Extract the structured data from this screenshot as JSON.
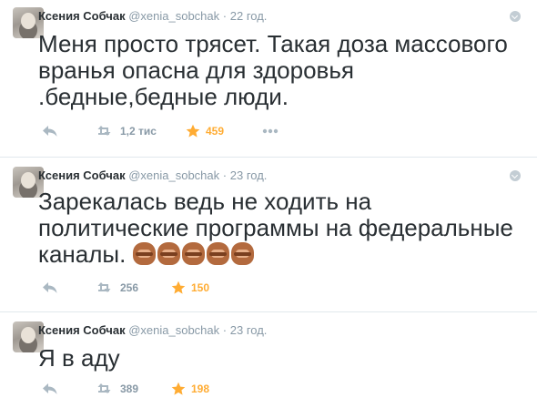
{
  "tweets": [
    {
      "name": "Ксения Собчак",
      "handle": "@xenia_sobchak",
      "separator": "·",
      "time": "22 год.",
      "text": "Меня просто трясет. Такая доза массового вранья опасна для здоровья .бедные,бедные люди.",
      "retweets": "1,2 тис",
      "favorites": "459",
      "emoji_count": 0
    },
    {
      "name": "Ксения Собчак",
      "handle": "@xenia_sobchak",
      "separator": "·",
      "time": "23 год.",
      "text": "Зарекалась ведь не ходить на политические программы на федеральные каналы.",
      "retweets": "256",
      "favorites": "150",
      "emoji_count": 5,
      "emoji_icon": "see-no-evil-monkey"
    },
    {
      "name": "Ксения Собчак",
      "handle": "@xenia_sobchak",
      "separator": "·",
      "time": "23 год.",
      "text": "Я в аду",
      "retweets": "389",
      "favorites": "198",
      "emoji_count": 0
    }
  ],
  "colors": {
    "text": "#292f33",
    "muted": "#8899a6",
    "favorite": "#ffac33",
    "divider": "#e1e8ed"
  },
  "icons": {
    "reply": "reply-icon",
    "retweet": "retweet-icon",
    "favorite": "star-icon",
    "more": "more-icon",
    "menu": "chevron-down-icon"
  }
}
